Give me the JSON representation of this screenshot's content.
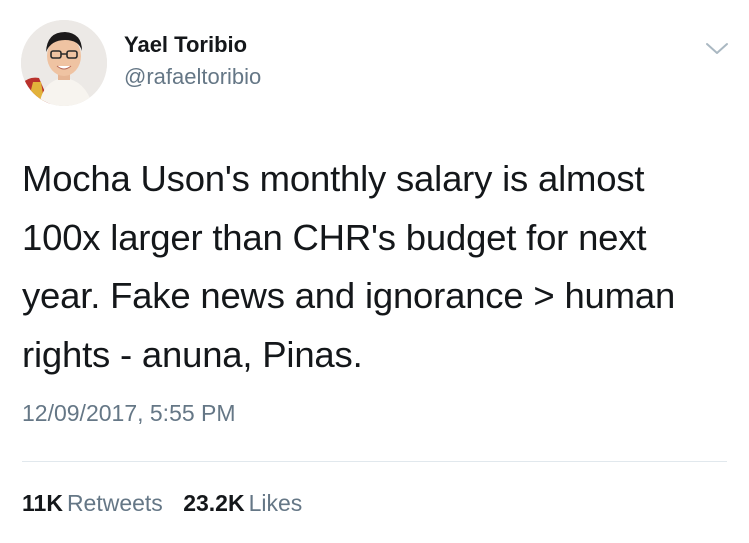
{
  "tweet": {
    "author": {
      "display_name": "Yael Toribio",
      "handle": "@rafaeltoribio"
    },
    "text_lines": [
      "Mocha Uson's monthly salary is almost",
      "100x larger than CHR's budget for next",
      "year. Fake news and ignorance > human",
      "rights - anuna, Pinas."
    ],
    "timestamp": "12/09/2017, 5:55 PM",
    "stats": {
      "retweets_count": "11K",
      "retweets_label": "Retweets",
      "likes_count": "23.2K",
      "likes_label": "Likes"
    },
    "menu_icon": "chevron-down-icon"
  },
  "colors": {
    "text_primary": "#14171a",
    "text_secondary": "#657786",
    "divider": "#e1e8ed"
  }
}
